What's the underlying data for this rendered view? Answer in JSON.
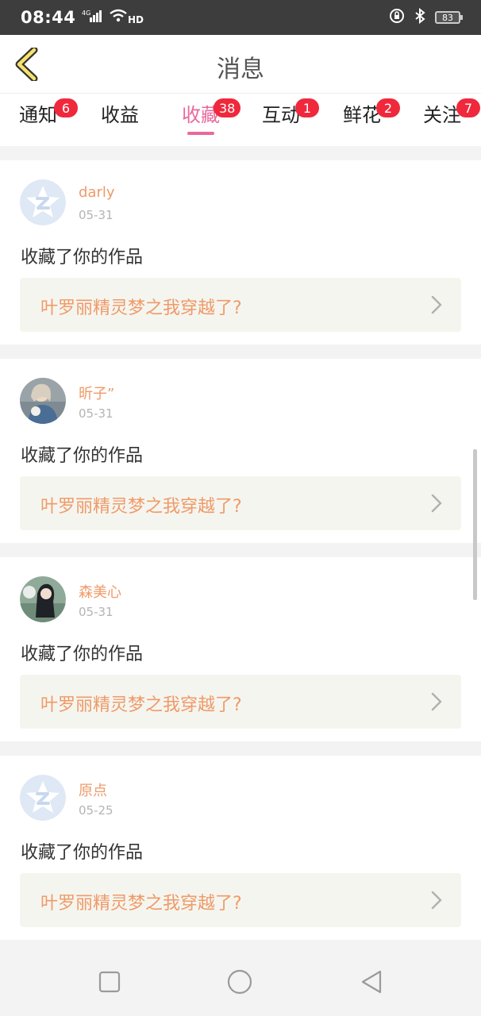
{
  "status_bar": {
    "time": "08:44",
    "network": "4G",
    "hd": "HD",
    "battery": "83"
  },
  "header": {
    "title": "消息"
  },
  "tabs": [
    {
      "label": "通知",
      "badge": "6",
      "active": false
    },
    {
      "label": "收益",
      "badge": "",
      "active": false
    },
    {
      "label": "收藏",
      "badge": "38",
      "active": true
    },
    {
      "label": "互动",
      "badge": "1",
      "active": false
    },
    {
      "label": "鲜花",
      "badge": "2",
      "active": false
    },
    {
      "label": "关注",
      "badge": "7",
      "active": false
    }
  ],
  "feed": [
    {
      "user": "darly",
      "date": "05-31",
      "action": "收藏了你的作品",
      "work_title": "叶罗丽精灵梦之我穿越了?",
      "avatar": "default-q-avatar"
    },
    {
      "user": "昕子”",
      "date": "05-31",
      "action": "收藏了你的作品",
      "work_title": "叶罗丽精灵梦之我穿越了?",
      "avatar": "photo-avatar"
    },
    {
      "user": "森美心",
      "date": "05-31",
      "action": "收藏了你的作品",
      "work_title": "叶罗丽精灵梦之我穿越了?",
      "avatar": "photo-avatar"
    },
    {
      "user": "原点",
      "date": "05-25",
      "action": "收藏了你的作品",
      "work_title": "叶罗丽精灵梦之我穿越了?",
      "avatar": "default-q-avatar"
    }
  ],
  "colors": {
    "accent": "#e8699c",
    "username": "#ef9a68",
    "badge": "#f0283c"
  }
}
